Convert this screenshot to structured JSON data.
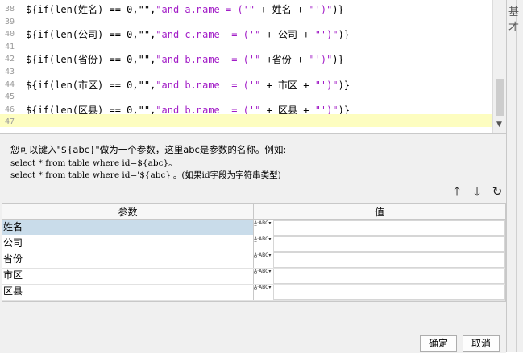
{
  "editor": {
    "lines": [
      {
        "num": "38",
        "parts": [
          [
            "k",
            "${if(len("
          ],
          [
            "n",
            "姓名"
          ],
          [
            "k",
            ") == 0,\"\","
          ],
          [
            "s",
            "\"and a.name = ('\""
          ],
          [
            "k",
            " + 姓名 + "
          ],
          [
            "s",
            "\"')\""
          ],
          [
            "k",
            ")}"
          ]
        ]
      },
      {
        "num": "39",
        "parts": []
      },
      {
        "num": "40",
        "parts": [
          [
            "k",
            "${if(len("
          ],
          [
            "n",
            "公司"
          ],
          [
            "k",
            ") == 0,\"\","
          ],
          [
            "s",
            "\"and c.name  = ('\""
          ],
          [
            "k",
            " + 公司 + "
          ],
          [
            "s",
            "\"')\""
          ],
          [
            "k",
            ")}"
          ]
        ]
      },
      {
        "num": "41",
        "parts": []
      },
      {
        "num": "42",
        "parts": [
          [
            "k",
            "${if(len("
          ],
          [
            "n",
            "省份"
          ],
          [
            "k",
            ") == 0,\"\","
          ],
          [
            "s",
            "\"and b.name  = ('\""
          ],
          [
            "k",
            " +省份 + "
          ],
          [
            "s",
            "\"')\""
          ],
          [
            "k",
            ")}"
          ]
        ]
      },
      {
        "num": "43",
        "parts": []
      },
      {
        "num": "44",
        "parts": [
          [
            "k",
            "${if(len("
          ],
          [
            "n",
            "市区"
          ],
          [
            "k",
            ") == 0,\"\","
          ],
          [
            "s",
            "\"and b.name  = ('\""
          ],
          [
            "k",
            " + 市区 + "
          ],
          [
            "s",
            "\"')\""
          ],
          [
            "k",
            ")}"
          ]
        ]
      },
      {
        "num": "45",
        "parts": []
      },
      {
        "num": "46",
        "parts": [
          [
            "k",
            "${if(len("
          ],
          [
            "n",
            "区县"
          ],
          [
            "k",
            ") == 0,\"\","
          ],
          [
            "s",
            "\"and b.name  = ('\""
          ],
          [
            "k",
            " + 区县 + "
          ],
          [
            "s",
            "\"')\""
          ],
          [
            "k",
            ")}"
          ]
        ]
      },
      {
        "num": "47",
        "parts": []
      }
    ]
  },
  "right_peek_text": "基才",
  "hint": {
    "line1": "您可以键入\"${abc}\"做为一个参数，这里abc是参数的名称。例如:",
    "line2": "select * from table where id=${abc}。",
    "line3": "select * from table where id='${abc}'。(如果id字段为字符串类型)"
  },
  "toolbar": {
    "up_icon": "arrow-up-icon",
    "up_glyph": "🡑",
    "down_icon": "arrow-down-icon",
    "down_glyph": "🡓",
    "refresh_icon": "refresh-icon",
    "refresh_glyph": "↻"
  },
  "table": {
    "headers": {
      "param": "参数",
      "value": "值"
    },
    "rows": [
      {
        "name": "姓名",
        "type_icon": "A̲·ABC",
        "value": ""
      },
      {
        "name": "公司",
        "type_icon": "A̲·ABC",
        "value": ""
      },
      {
        "name": "省份",
        "type_icon": "A̲·ABC",
        "value": ""
      },
      {
        "name": "市区",
        "type_icon": "A̲·ABC",
        "value": ""
      },
      {
        "name": "区县",
        "type_icon": "A̲·ABC",
        "value": ""
      }
    ],
    "selected_row": 0
  },
  "buttons": {
    "ok": "确定",
    "cancel": "取消"
  }
}
